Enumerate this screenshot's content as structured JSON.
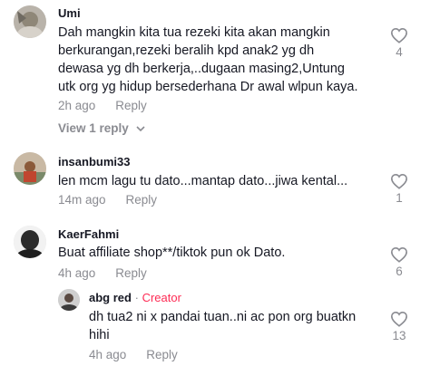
{
  "comments": [
    {
      "username": "Umi",
      "text_lines": [
        "Dah mangkin kita tua rezeki kita akan mangkin",
        "berkurangan,rezeki beralih kpd anak2 yg dh",
        "dewasa yg dh berkerja,..dugaan masing2,Untung",
        "utk org yg hidup bersederhana Dr awal wlpun kaya."
      ],
      "time": "2h ago",
      "reply_label": "Reply",
      "view_replies": "View 1 reply",
      "likes": "4"
    },
    {
      "username": "insanbumi33",
      "text_lines": [
        "len mcm lagu tu dato...mantap dato...jiwa kental..."
      ],
      "time": "14m ago",
      "reply_label": "Reply",
      "likes": "1"
    },
    {
      "username": "KaerFahmi",
      "text_lines": [
        "Buat affiliate shop**/tiktok pun ok Dato."
      ],
      "time": "4h ago",
      "reply_label": "Reply",
      "likes": "6"
    }
  ],
  "reply": {
    "username": "abg red",
    "separator": "·",
    "badge": "Creator",
    "text_lines": [
      "dh tua2 ni x pandai tuan..ni ac pon org buatkn",
      "hihi"
    ],
    "time": "4h ago",
    "reply_label": "Reply",
    "likes": "13"
  },
  "icons": {
    "like": "heart-outline-icon",
    "expand": "chevron-down-icon"
  },
  "colors": {
    "primary_text": "#161823",
    "secondary_text": "#8a8b91",
    "creator_badge": "#fe2c55"
  }
}
